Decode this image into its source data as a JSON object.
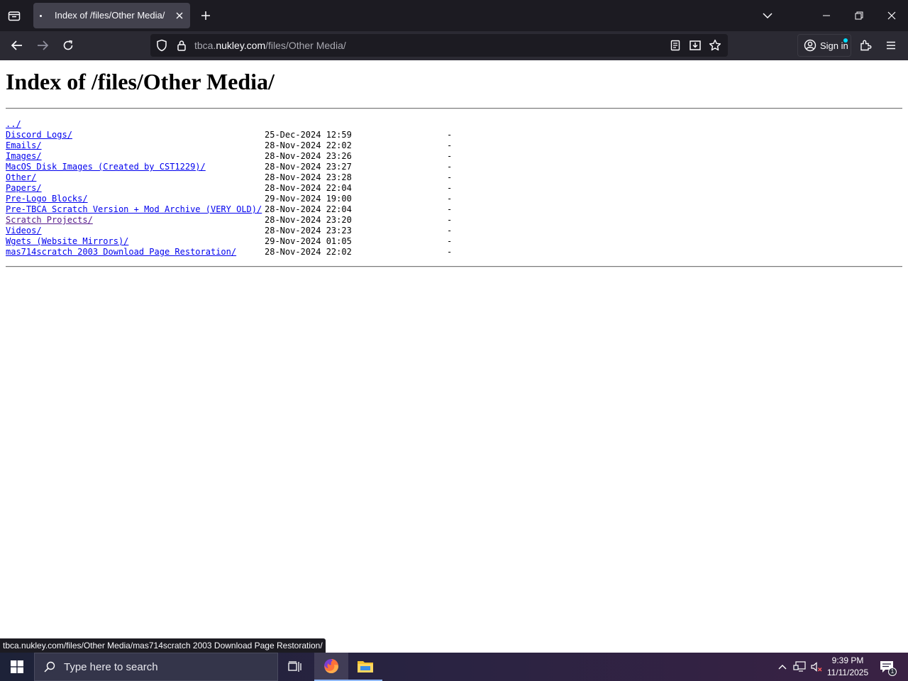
{
  "browser": {
    "tab": {
      "title": "Index of /files/Other Media/"
    },
    "url": {
      "subdomain": "tbca.",
      "domain": "nukley.com",
      "path": "/files/Other Media/"
    },
    "signin_label": "Sign in"
  },
  "page": {
    "heading": "Index of /files/Other Media/",
    "parent_link": "../",
    "entries": [
      {
        "name": "Discord Logs/",
        "date": "25-Dec-2024 12:59",
        "size": "-",
        "visited": false
      },
      {
        "name": "Emails/",
        "date": "28-Nov-2024 22:02",
        "size": "-",
        "visited": false
      },
      {
        "name": "Images/",
        "date": "28-Nov-2024 23:26",
        "size": "-",
        "visited": false
      },
      {
        "name": "MacOS Disk Images (Created by CST1229)/",
        "date": "28-Nov-2024 23:27",
        "size": "-",
        "visited": false
      },
      {
        "name": "Other/",
        "date": "28-Nov-2024 23:28",
        "size": "-",
        "visited": false
      },
      {
        "name": "Papers/",
        "date": "28-Nov-2024 22:04",
        "size": "-",
        "visited": false
      },
      {
        "name": "Pre-Logo Blocks/",
        "date": "29-Nov-2024 19:00",
        "size": "-",
        "visited": false
      },
      {
        "name": "Pre-TBCA Scratch Version + Mod Archive (VERY OLD)/",
        "date": "28-Nov-2024 22:04",
        "size": "-",
        "visited": false
      },
      {
        "name": "Scratch Projects/",
        "date": "28-Nov-2024 23:20",
        "size": "-",
        "visited": true
      },
      {
        "name": "Videos/",
        "date": "28-Nov-2024 23:23",
        "size": "-",
        "visited": false
      },
      {
        "name": "Wgets (Website Mirrors)/",
        "date": "29-Nov-2024 01:05",
        "size": "-",
        "visited": false
      },
      {
        "name": "mas714scratch 2003 Download Page Restoration/",
        "date": "28-Nov-2024 22:02",
        "size": "-",
        "visited": false
      }
    ]
  },
  "status_bar": {
    "text": "tbca.nukley.com/files/Other Media/mas714scratch 2003 Download Page Restoration/"
  },
  "taskbar": {
    "search_placeholder": "Type here to search",
    "time": "9:39 PM",
    "date": "11/11/2025",
    "notification_count": "1"
  },
  "colors": {
    "link": "#0000ee",
    "visited_link": "#551a8b",
    "tab_bg": "#42414d",
    "toolbar_bg": "#2b2a33",
    "frame_bg": "#1c1b22"
  },
  "icons": [
    "tab-list-icon",
    "close-icon",
    "plus-icon",
    "chevron-down-icon",
    "minimize-icon",
    "restore-icon",
    "back-arrow-icon",
    "forward-arrow-icon",
    "reload-icon",
    "shield-icon",
    "lock-icon",
    "reader-view-icon",
    "save-to-pocket-icon",
    "star-icon",
    "account-icon",
    "extensions-icon",
    "hamburger-menu-icon",
    "windows-logo-icon",
    "search-icon",
    "task-view-icon",
    "firefox-icon",
    "file-explorer-icon",
    "chevron-up-icon",
    "network-icon",
    "speaker-muted-icon",
    "notification-icon"
  ]
}
